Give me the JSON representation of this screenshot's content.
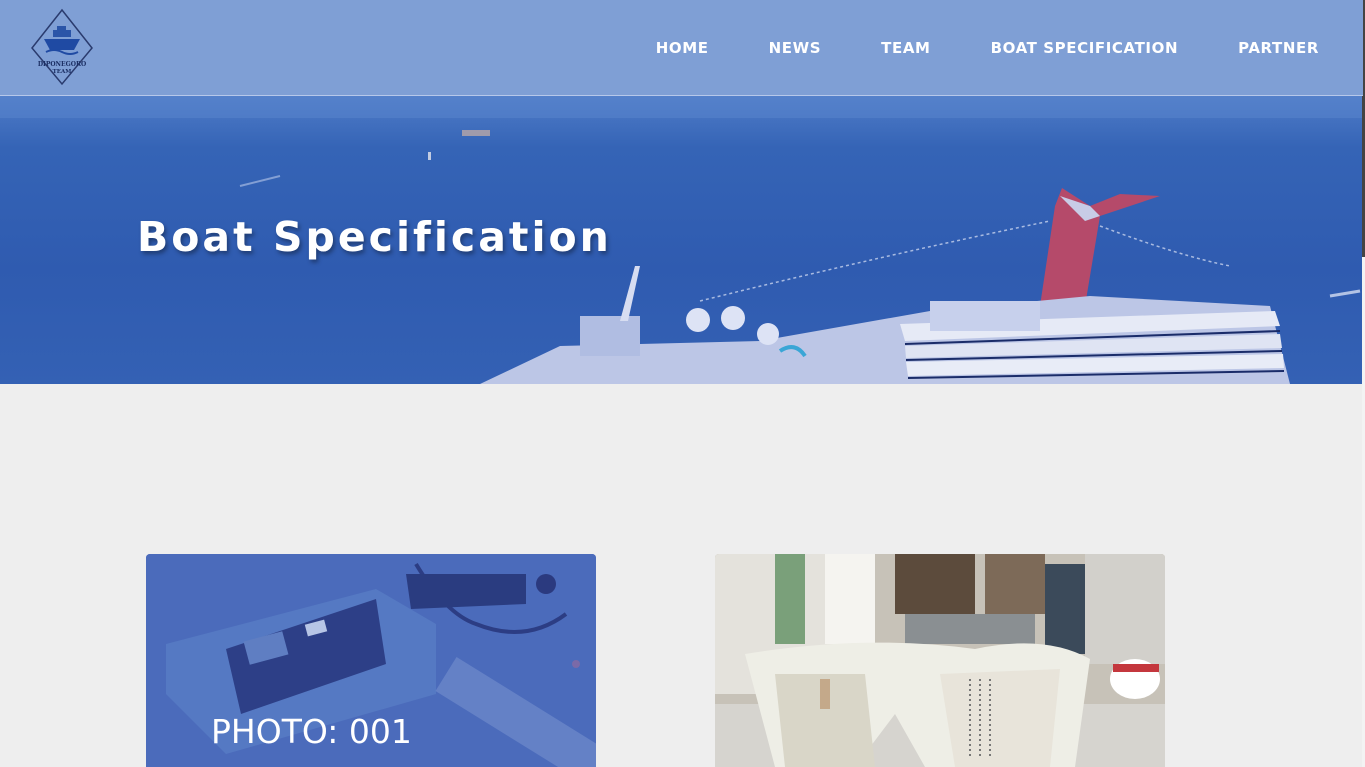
{
  "logo": {
    "text_top": "DIPONEGORO",
    "text_bottom": "TEAM"
  },
  "nav": {
    "items": [
      "HOME",
      "NEWS",
      "TEAM",
      "BOAT SPECIFICATION",
      "PARTNER"
    ]
  },
  "hero": {
    "title": "Boat Specification"
  },
  "gallery": {
    "cards": [
      {
        "caption": "PHOTO: 001"
      },
      {
        "caption": ""
      }
    ]
  },
  "colors": {
    "navbar": "#7f9fd5",
    "hero_overlay": "#2f5bb0",
    "page_background": "#eeeeee",
    "card_overlay": "#4868b9"
  }
}
